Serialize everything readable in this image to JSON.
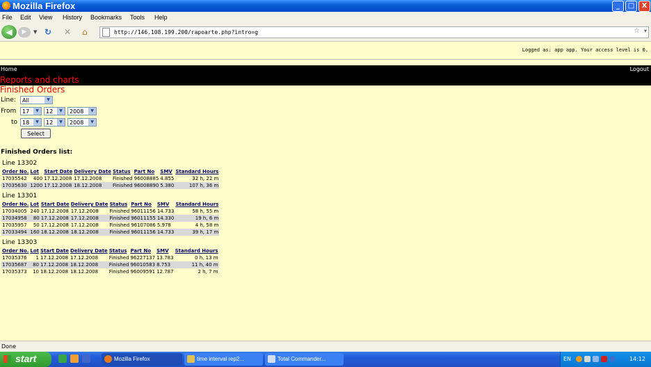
{
  "window": {
    "title": "Mozilla Firefox",
    "minimize": "_",
    "maximize": "□",
    "close": "X"
  },
  "menu": [
    "File",
    "Edit",
    "View",
    "History",
    "Bookmarks",
    "Tools",
    "Help"
  ],
  "nav": {
    "url": "http://146.108.199.200/rapoarte.php?intro=g",
    "back_icon": "left-arrow-icon",
    "forward_icon": "right-arrow-icon"
  },
  "page": {
    "logged_in": "Logged as: app app. Your access level is 0.",
    "home": "Home",
    "logout": "Logout",
    "section": "Reports and charts",
    "heading": "Finished Orders",
    "form": {
      "line_label": "Line:",
      "line_value": "All",
      "from_label": "From",
      "to_label": "to",
      "from_day": "17",
      "from_month": "12",
      "from_year": "2008",
      "to_day": "18",
      "to_month": "12",
      "to_year": "2008",
      "select_button": "Select"
    },
    "list_title": "Finished Orders list:",
    "groups": [
      {
        "title": "Line 13302",
        "headers": [
          "Order No.",
          "Lot",
          "Start Date",
          "Delivery Date",
          "Status",
          "Part No",
          "SMV",
          "Standard Hours"
        ],
        "rows": [
          [
            "17035542",
            "400",
            "17.12.2008",
            "17.12.2008",
            "Finished",
            "96008885",
            "4.855",
            "32 h, 22 m"
          ],
          [
            "17035630",
            "1200",
            "17.12.2008",
            "18.12.2008",
            "Finished",
            "96008890",
            "5.380",
            "107 h, 36 m"
          ]
        ]
      },
      {
        "title": "Line 13301",
        "headers": [
          "Order No.",
          "Lot",
          "Start Date",
          "Delivery Date",
          "Status",
          "Part No",
          "SMV",
          "Standard Hours"
        ],
        "rows": [
          [
            "17034005",
            "240",
            "17.12.2008",
            "17.12.2008",
            "Finished",
            "96011156",
            "14.733",
            "58 h, 55 m"
          ],
          [
            "17034958",
            "80",
            "17.12.2008",
            "17.12.2008",
            "Finished",
            "96011155",
            "14.330",
            "19 h, 6 m"
          ],
          [
            "17035957",
            "50",
            "17.12.2008",
            "17.12.2008",
            "Finished",
            "96107086",
            "5.978",
            "4 h, 58 m"
          ],
          [
            "17033494",
            "160",
            "18.12.2008",
            "18.12.2008",
            "Finished",
            "96011156",
            "14.733",
            "39 h, 17 m"
          ]
        ]
      },
      {
        "title": "Line 13303",
        "headers": [
          "Order No.",
          "Lot",
          "Start Date",
          "Delivery Date",
          "Status",
          "Part No",
          "SMV",
          "Standard Hours"
        ],
        "rows": [
          [
            "17035376",
            "1",
            "17.12.2008",
            "17.12.2008",
            "Finished",
            "96227137",
            "13.783",
            "0 h, 13 m"
          ],
          [
            "17035687",
            "80",
            "17.12.2008",
            "18.12.2008",
            "Finished",
            "96010583",
            "8.753",
            "11 h, 40 m"
          ],
          [
            "17035373",
            "10",
            "18.12.2008",
            "18.12.2008",
            "Finished",
            "96009591",
            "12.787",
            "2 h, 7 m"
          ]
        ]
      }
    ]
  },
  "status": "Done",
  "taskbar": {
    "start": "start",
    "tasks": [
      "Mozilla Firefox",
      "time interval rep2...",
      "Total Commander..."
    ],
    "lang": "EN",
    "clock": "14:12"
  },
  "colors": {
    "accent_red": "#ff0000",
    "page_bg": "#ffffcc",
    "row_alt": "#d9d9d9"
  }
}
